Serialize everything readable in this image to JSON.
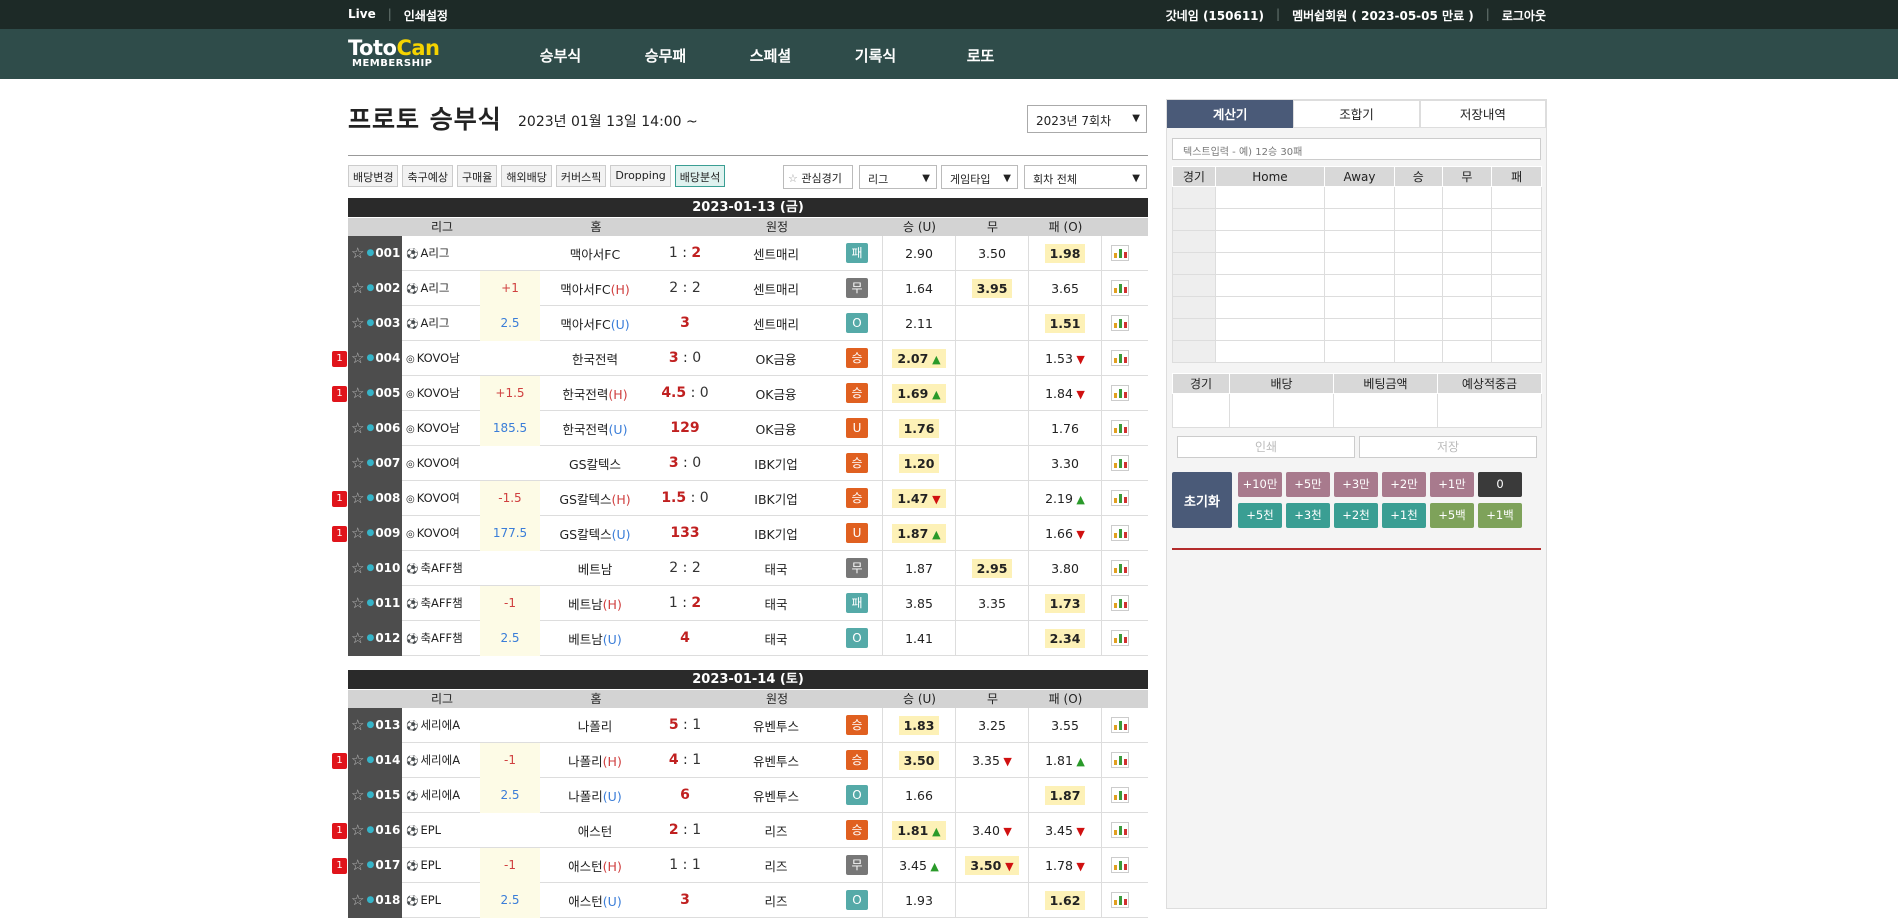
{
  "topbar": {
    "live": "Live",
    "print": "인쇄설정",
    "user": "갓네임 (150611)",
    "member": "멤버쉽회원 ( 2023-05-05 만료 )",
    "logout": "로그아웃"
  },
  "logo": {
    "main": "Toto",
    "accent": "Can",
    "sub": "MEMBERSHIP"
  },
  "menu": [
    "승부식",
    "승무패",
    "스페셜",
    "기록식",
    "로또"
  ],
  "page": {
    "title": "프로토 승부식",
    "subtitle": "2023년 01월 13일 14:00 ~",
    "round": "2023년 7회차"
  },
  "toolbar": {
    "buttons": [
      "배당변경",
      "축구예상",
      "구매율",
      "해외배당",
      "커버스픽",
      "Dropping",
      "배당분석"
    ],
    "fav": "관심경기",
    "league": "리그",
    "gametype": "게임타입",
    "roundAll": "회차 전체"
  },
  "cols": {
    "league": "리그",
    "home": "홈",
    "away": "원정",
    "win": "승 (U)",
    "draw": "무",
    "lose": "패 (O)"
  },
  "days": [
    {
      "label": "2023-01-13 (금)",
      "rows": [
        {
          "no": "001",
          "league": "A리그",
          "icon": "⚽",
          "hc": "",
          "home": "맥아서FC",
          "hs": "1",
          "as": "2",
          "away": "센트매리",
          "res": "패",
          "rc": "#55aaa8",
          "w": "2.90",
          "d": "3.50",
          "l": "1.98",
          "hl": "l",
          "flag": ""
        },
        {
          "no": "002",
          "league": "A리그",
          "icon": "⚽",
          "hc": "+1",
          "hcc": "#d04040",
          "home": "맥아서FC",
          "tag": "H",
          "hs": "2",
          "as": "2",
          "away": "센트매리",
          "res": "무",
          "rc": "#777",
          "w": "1.64",
          "d": "3.95",
          "l": "3.65",
          "hl": "d",
          "flag": ""
        },
        {
          "no": "003",
          "league": "A리그",
          "icon": "⚽",
          "hc": "2.5",
          "hcc": "#3a7dd8",
          "home": "맥아서FC",
          "tag": "U",
          "hs": "3",
          "as": "",
          "away": "센트매리",
          "res": "O",
          "rc": "#55aaa8",
          "w": "2.11",
          "d": "",
          "l": "1.51",
          "hl": "l",
          "flag": ""
        },
        {
          "no": "004",
          "league": "KOVO남",
          "icon": "◎",
          "hc": "",
          "home": "한국전력",
          "hs": "3",
          "as": "0",
          "away": "OK금융",
          "res": "승",
          "rc": "#e06020",
          "w": "2.07",
          "wa": "up",
          "d": "",
          "l": "1.53",
          "la": "dn",
          "hl": "w",
          "flag": "1"
        },
        {
          "no": "005",
          "league": "KOVO남",
          "icon": "◎",
          "hc": "+1.5",
          "hcc": "#d04040",
          "home": "한국전력",
          "tag": "H",
          "hs": "4.5",
          "as": "0",
          "away": "OK금융",
          "res": "승",
          "rc": "#e06020",
          "w": "1.69",
          "wa": "up",
          "d": "",
          "l": "1.84",
          "la": "dn",
          "hl": "w",
          "flag": "1"
        },
        {
          "no": "006",
          "league": "KOVO남",
          "icon": "◎",
          "hc": "185.5",
          "hcc": "#3a7dd8",
          "home": "한국전력",
          "tag": "U",
          "hs": "129",
          "as": "",
          "away": "OK금융",
          "res": "U",
          "rc": "#e06020",
          "w": "1.76",
          "d": "",
          "l": "1.76",
          "hl": "w",
          "flag": ""
        },
        {
          "no": "007",
          "league": "KOVO여",
          "icon": "◎",
          "hc": "",
          "home": "GS칼텍스",
          "hs": "3",
          "as": "0",
          "away": "IBK기업",
          "res": "승",
          "rc": "#e06020",
          "w": "1.20",
          "d": "",
          "l": "3.30",
          "hl": "w",
          "flag": ""
        },
        {
          "no": "008",
          "league": "KOVO여",
          "icon": "◎",
          "hc": "-1.5",
          "hcc": "#d04040",
          "home": "GS칼텍스",
          "tag": "H",
          "hs": "1.5",
          "as": "0",
          "away": "IBK기업",
          "res": "승",
          "rc": "#e06020",
          "w": "1.47",
          "wa": "dn",
          "d": "",
          "l": "2.19",
          "la": "up",
          "hl": "w",
          "flag": "1"
        },
        {
          "no": "009",
          "league": "KOVO여",
          "icon": "◎",
          "hc": "177.5",
          "hcc": "#3a7dd8",
          "home": "GS칼텍스",
          "tag": "U",
          "hs": "133",
          "as": "",
          "away": "IBK기업",
          "res": "U",
          "rc": "#e06020",
          "w": "1.87",
          "wa": "up",
          "d": "",
          "l": "1.66",
          "la": "dn",
          "hl": "w",
          "flag": "1"
        },
        {
          "no": "010",
          "league": "축AFF챔",
          "icon": "⚽",
          "hc": "",
          "home": "베트남",
          "hs": "2",
          "as": "2",
          "away": "태국",
          "res": "무",
          "rc": "#777",
          "w": "1.87",
          "d": "2.95",
          "l": "3.80",
          "hl": "d",
          "flag": ""
        },
        {
          "no": "011",
          "league": "축AFF챔",
          "icon": "⚽",
          "hc": "-1",
          "hcc": "#d04040",
          "home": "베트남",
          "tag": "H",
          "hs": "1",
          "as": "2",
          "away": "태국",
          "res": "패",
          "rc": "#55aaa8",
          "w": "3.85",
          "d": "3.35",
          "l": "1.73",
          "hl": "l",
          "flag": ""
        },
        {
          "no": "012",
          "league": "축AFF챔",
          "icon": "⚽",
          "hc": "2.5",
          "hcc": "#3a7dd8",
          "home": "베트남",
          "tag": "U",
          "hs": "4",
          "as": "",
          "away": "태국",
          "res": "O",
          "rc": "#55aaa8",
          "w": "1.41",
          "d": "",
          "l": "2.34",
          "hl": "l",
          "flag": ""
        }
      ]
    },
    {
      "label": "2023-01-14 (토)",
      "rows": [
        {
          "no": "013",
          "league": "세리에A",
          "icon": "⚽",
          "hc": "",
          "home": "나폴리",
          "hs": "5",
          "as": "1",
          "away": "유벤투스",
          "res": "승",
          "rc": "#e06020",
          "w": "1.83",
          "d": "3.25",
          "l": "3.55",
          "hl": "w",
          "flag": ""
        },
        {
          "no": "014",
          "league": "세리에A",
          "icon": "⚽",
          "hc": "-1",
          "hcc": "#d04040",
          "home": "나폴리",
          "tag": "H",
          "hs": "4",
          "as": "1",
          "away": "유벤투스",
          "res": "승",
          "rc": "#e06020",
          "w": "3.50",
          "d": "3.35",
          "da": "dn",
          "l": "1.81",
          "la": "up",
          "hl": "w",
          "flag": "1"
        },
        {
          "no": "015",
          "league": "세리에A",
          "icon": "⚽",
          "hc": "2.5",
          "hcc": "#3a7dd8",
          "home": "나폴리",
          "tag": "U",
          "hs": "6",
          "as": "",
          "away": "유벤투스",
          "res": "O",
          "rc": "#55aaa8",
          "w": "1.66",
          "d": "",
          "l": "1.87",
          "hl": "l",
          "flag": ""
        },
        {
          "no": "016",
          "league": "EPL",
          "icon": "⚽",
          "hc": "",
          "home": "애스턴",
          "hs": "2",
          "as": "1",
          "away": "리즈",
          "res": "승",
          "rc": "#e06020",
          "w": "1.81",
          "wa": "up",
          "d": "3.40",
          "da": "dn",
          "l": "3.45",
          "la": "dn",
          "hl": "w",
          "flag": "1"
        },
        {
          "no": "017",
          "league": "EPL",
          "icon": "⚽",
          "hc": "-1",
          "hcc": "#d04040",
          "home": "애스턴",
          "tag": "H",
          "hs": "1",
          "as": "1",
          "away": "리즈",
          "res": "무",
          "rc": "#777",
          "w": "3.45",
          "wa": "up",
          "d": "3.50",
          "da": "dn",
          "l": "1.78",
          "la": "dn",
          "hl": "d",
          "flag": "1"
        },
        {
          "no": "018",
          "league": "EPL",
          "icon": "⚽",
          "hc": "2.5",
          "hcc": "#3a7dd8",
          "home": "애스턴",
          "tag": "U",
          "hs": "3",
          "as": "",
          "away": "리즈",
          "res": "O",
          "rc": "#55aaa8",
          "w": "1.93",
          "d": "",
          "l": "1.62",
          "hl": "l",
          "flag": ""
        }
      ]
    }
  ],
  "side": {
    "tabs": [
      "계산기",
      "조합기",
      "저장내역"
    ],
    "text": "텍스트입력 - 예) 12승 30패",
    "grid": [
      "경기",
      "Home",
      "Away",
      "승",
      "무",
      "패"
    ],
    "bet": [
      "경기",
      "배당",
      "베팅금액",
      "예상적중금"
    ],
    "print": "인쇄",
    "save": "저장",
    "reset": "초기화",
    "keys1": [
      "+10만",
      "+5만",
      "+3만",
      "+2만",
      "+1만",
      "0"
    ],
    "keys2": [
      "+5천",
      "+3천",
      "+2천",
      "+1천",
      "+5백",
      "+1백"
    ]
  }
}
